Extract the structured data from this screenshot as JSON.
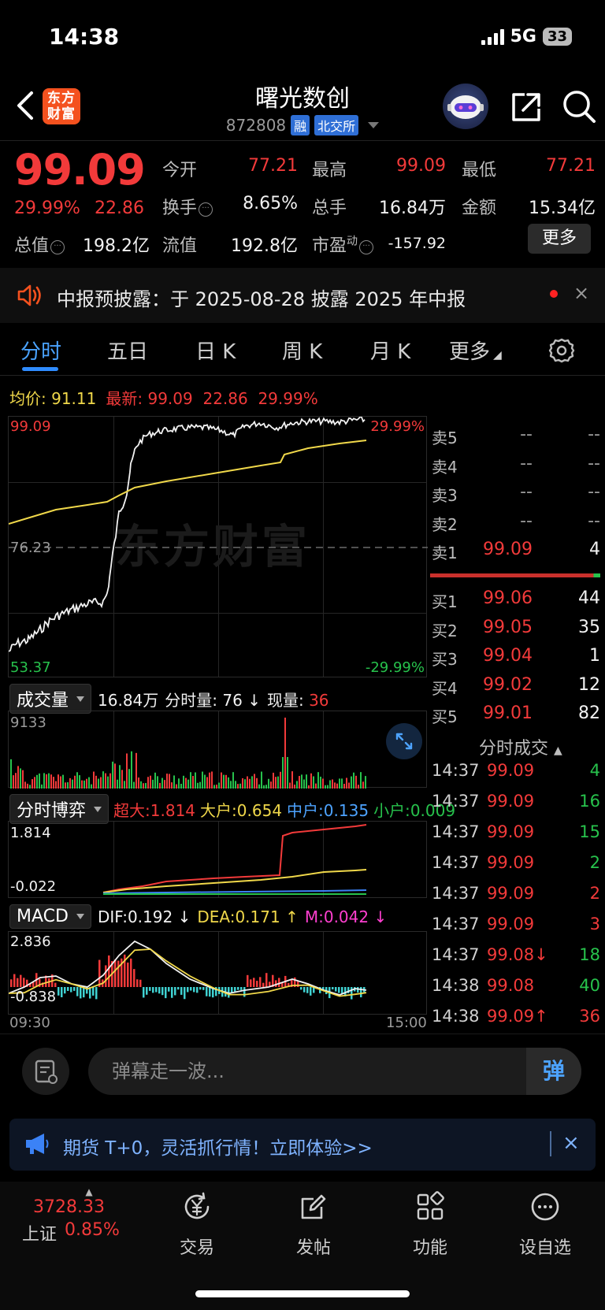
{
  "status": {
    "time": "14:38",
    "network": "5G",
    "battery": "33"
  },
  "header": {
    "logo_line1": "东方",
    "logo_line2": "财富",
    "name": "曙光数创",
    "code": "872808",
    "tag_margin": "融",
    "tag_exchange": "北交所"
  },
  "quote": {
    "last": "99.09",
    "change_pct": "29.99%",
    "change_amt": "22.86",
    "open_label": "今开",
    "open": "77.21",
    "high_label": "最高",
    "high": "99.09",
    "low_label": "最低",
    "low": "77.21",
    "turnover_label": "换手",
    "turnover": "8.65%",
    "volume_label": "总手",
    "volume": "16.84万",
    "amount_label": "金额",
    "amount": "15.34亿",
    "mktcap_label": "总值",
    "mktcap": "198.2亿",
    "float_label": "流值",
    "float": "192.8亿",
    "pe_label": "市盈",
    "pe_sup": "动",
    "pe": "-157.92",
    "more": "更多"
  },
  "notice": {
    "text": "中报预披露：于 2025-08-28 披露 2025 年中报",
    "close": "×"
  },
  "tabs": [
    "分时",
    "五日",
    "日 K",
    "周 K",
    "月 K",
    "更多"
  ],
  "intraday": {
    "avg_label": "均价:",
    "avg": "91.11",
    "latest_label": "最新:",
    "latest": "99.09",
    "latest_chg": "22.86",
    "latest_pct": "29.99%",
    "y_top": "99.09",
    "y_mid": "76.23",
    "y_bottom": "53.37",
    "pct_top": "29.99%",
    "pct_bottom": "-29.99%",
    "watermark": "东方财富"
  },
  "volume_panel": {
    "label": "成交量",
    "total": "16.84万",
    "minute_label": "分时量:",
    "minute": "76",
    "now_label": "现量:",
    "now": "36",
    "y_max": "9133"
  },
  "game_panel": {
    "label": "分时博弈",
    "super_label": "超大:",
    "super": "1.814",
    "large_label": "大户:",
    "large": "0.654",
    "mid_label": "中户:",
    "mid": "0.135",
    "small_label": "小户:",
    "small": "0.009",
    "y_max": "1.814",
    "y_min": "-0.022"
  },
  "macd_panel": {
    "label": "MACD",
    "dif_label": "DIF:",
    "dif": "0.192",
    "dea_label": "DEA:",
    "dea": "0.171",
    "m_label": "M:",
    "m": "0.042",
    "y_max": "2.836",
    "y_min": "-0.838",
    "x_start": "09:30",
    "x_end": "15:00"
  },
  "orderbook": {
    "asks": [
      {
        "label": "卖5",
        "price": "--",
        "vol": "--"
      },
      {
        "label": "卖4",
        "price": "--",
        "vol": "--"
      },
      {
        "label": "卖3",
        "price": "--",
        "vol": "--"
      },
      {
        "label": "卖2",
        "price": "--",
        "vol": "--"
      },
      {
        "label": "卖1",
        "price": "99.09",
        "vol": "4"
      }
    ],
    "bids": [
      {
        "label": "买1",
        "price": "99.06",
        "vol": "44"
      },
      {
        "label": "买2",
        "price": "99.05",
        "vol": "35"
      },
      {
        "label": "买3",
        "price": "99.04",
        "vol": "1"
      },
      {
        "label": "买4",
        "price": "99.02",
        "vol": "12"
      },
      {
        "label": "买5",
        "price": "99.01",
        "vol": "82"
      }
    ]
  },
  "trades": {
    "title": "分时成交",
    "rows": [
      {
        "time": "14:37",
        "price": "99.09",
        "vol": "4",
        "side": "buy"
      },
      {
        "time": "14:37",
        "price": "99.09",
        "vol": "16",
        "side": "buy"
      },
      {
        "time": "14:37",
        "price": "99.09",
        "vol": "15",
        "side": "buy"
      },
      {
        "time": "14:37",
        "price": "99.09",
        "vol": "2",
        "side": "buy"
      },
      {
        "time": "14:37",
        "price": "99.09",
        "vol": "2",
        "side": "sell"
      },
      {
        "time": "14:37",
        "price": "99.09",
        "vol": "3",
        "side": "sell"
      },
      {
        "time": "14:37",
        "price": "99.08↓",
        "vol": "18",
        "side": "buy"
      },
      {
        "time": "14:38",
        "price": "99.08",
        "vol": "40",
        "side": "buy"
      },
      {
        "time": "14:38",
        "price": "99.09↑",
        "vol": "36",
        "side": "sell"
      }
    ]
  },
  "comment": {
    "placeholder": "弹幕走一波...",
    "send": "弹"
  },
  "ad": {
    "text": "期货 T+0，灵活抓行情！立即体验>>",
    "close": "×"
  },
  "nav": {
    "index_value": "3728.33",
    "index_name": "上证",
    "index_pct": "0.85%",
    "items": [
      "交易",
      "发帖",
      "功能",
      "设自选"
    ]
  },
  "colors": {
    "up": "#f23a3a",
    "down": "#27c24c",
    "avg": "#f0d84a",
    "accent": "#2f8cff"
  }
}
